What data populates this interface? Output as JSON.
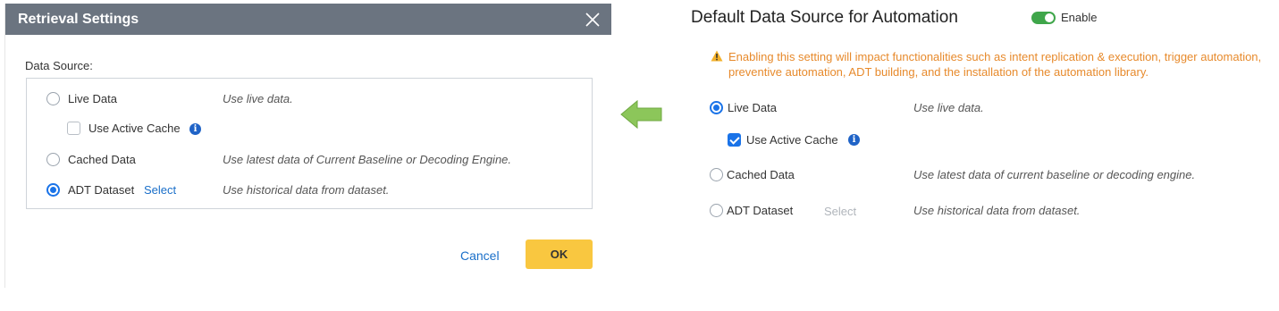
{
  "dialog": {
    "title": "Retrieval Settings",
    "data_source_label": "Data Source:",
    "options": {
      "live": {
        "label": "Live Data",
        "desc": "Use live data.",
        "checked": false
      },
      "active_cache": {
        "label": "Use Active Cache",
        "checked": false
      },
      "cached": {
        "label": "Cached Data",
        "desc": "Use latest data of Current Baseline or Decoding Engine.",
        "checked": false
      },
      "adt": {
        "label": "ADT Dataset",
        "link": "Select",
        "desc": "Use historical data from dataset.",
        "checked": true
      }
    },
    "cancel_label": "Cancel",
    "ok_label": "OK"
  },
  "panel": {
    "title": "Default Data Source for Automation",
    "toggle_label": "Enable",
    "toggle_on": true,
    "warning": "Enabling this setting will impact functionalities such as intent replication & execution, trigger automation, preventive automation, ADT building, and the installation of the automation library.",
    "options": {
      "live": {
        "label": "Live Data",
        "desc": "Use live data.",
        "checked": true
      },
      "active_cache": {
        "label": "Use Active Cache",
        "checked": true
      },
      "cached": {
        "label": "Cached Data",
        "desc": "Use latest data of current baseline or decoding engine.",
        "checked": false
      },
      "adt": {
        "label": "ADT Dataset",
        "link": "Select",
        "desc": "Use historical data from dataset.",
        "checked": false
      }
    }
  },
  "colors": {
    "header": "#6b7480",
    "accent": "#1a73e8",
    "ok_button": "#f9c740",
    "warning": "#e78a2c",
    "toggle_on": "#3fa64a",
    "arrow": "#8cc65a"
  },
  "icons": [
    "close-icon",
    "info-icon",
    "left-arrow-icon",
    "warning-icon",
    "toggle-switch"
  ]
}
